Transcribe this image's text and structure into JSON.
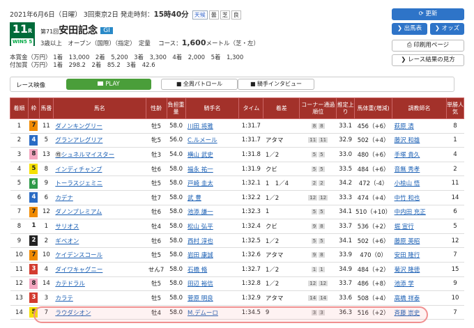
{
  "header": {
    "date": "2021年6月6日（日曜）",
    "meeting": "3回東京2日",
    "post_time_label": "発走時刻：",
    "post_time": "15時40分",
    "conditions": [
      "天候",
      "曇",
      "芝",
      "良"
    ],
    "race_no": "11",
    "race_no_suffix": "R",
    "win5_label": "WIN5",
    "win5_no": "5",
    "race_ordinal": "第71回",
    "race_name": "安田記念",
    "grade": "GI",
    "class_text": "3歳以上　オープン（国際）（指定）　定量",
    "course_label": "コース：",
    "distance": "1,600",
    "distance_unit": "メートル（芝・左）"
  },
  "prize": {
    "row1_label": "本賞金（万円）",
    "row1": "1着　13,000　2着　5,200　3着　3,300　4着　2,000　5着　1,300",
    "row2_label": "付加賞（万円）",
    "row2": "1着　298.2　2着　85.2　3着　42.6"
  },
  "buttons": {
    "refresh": "更新",
    "entries": "出馬表",
    "odds": "オッズ",
    "print": "印刷用ページ",
    "results_guide": "レース結果の見方"
  },
  "video": {
    "label": "レース映像",
    "play": "PLAY",
    "patrol": "全周パトロール",
    "interview": "騎手インタビュー"
  },
  "table": {
    "headers": [
      "着順",
      "枠",
      "馬番",
      "馬名",
      "性齢",
      "負担重量",
      "騎手名",
      "タイム",
      "着差",
      "コーナー通過順位",
      "推定上り",
      "馬体重(増減)",
      "調教師名",
      "単勝人気"
    ],
    "rows": [
      {
        "rank": "1",
        "waku": "7",
        "num": "11",
        "horse": "ダノンキングリー",
        "sex": "牡5",
        "weight": "58.0",
        "jockey": "川田 将雅",
        "time": "1:31.7",
        "margin": "",
        "corner": [
          "8",
          "8"
        ],
        "last3f": "33.1",
        "bw": "456（+6）",
        "trainer": "萩原 清",
        "pop": "8"
      },
      {
        "rank": "2",
        "waku": "4",
        "num": "5",
        "horse": "グランアレグリア",
        "sex": "牝5",
        "weight": "56.0",
        "jockey": "C.ルメール",
        "time": "1:31.7",
        "margin": "アタマ",
        "corner": [
          "11",
          "11"
        ],
        "last3f": "32.9",
        "bw": "502（+4）",
        "trainer": "藤沢 和雄",
        "pop": "1"
      },
      {
        "rank": "3",
        "waku": "8",
        "num": "13",
        "horse": "シュネルマイスター",
        "sex": "牡3",
        "weight": "54.0",
        "jockey": "横山 武史",
        "time": "1:31.8",
        "margin": "1／2",
        "corner": [
          "5",
          "5"
        ],
        "last3f": "33.0",
        "bw": "480（+6）",
        "trainer": "手塚 貴久",
        "pop": "4"
      },
      {
        "rank": "4",
        "waku": "5",
        "num": "8",
        "horse": "インディチャンプ",
        "sex": "牡6",
        "weight": "58.0",
        "jockey": "福永 祐一",
        "time": "1:31.9",
        "margin": "クビ",
        "corner": [
          "5",
          "5"
        ],
        "last3f": "33.5",
        "bw": "484（+6）",
        "trainer": "音無 秀孝",
        "pop": "2"
      },
      {
        "rank": "5",
        "waku": "6",
        "num": "9",
        "horse": "トーラスジェミニ",
        "sex": "牡5",
        "weight": "58.0",
        "jockey": "戸崎 圭太",
        "time": "1:32.1",
        "margin": "1　1／4",
        "corner": [
          "2",
          "2"
        ],
        "last3f": "34.2",
        "bw": "472（-4）",
        "trainer": "小桧山 悟",
        "pop": "11"
      },
      {
        "rank": "6",
        "waku": "4",
        "num": "6",
        "horse": "カデナ",
        "sex": "牡7",
        "weight": "58.0",
        "jockey": "武 豊",
        "time": "1:32.2",
        "margin": "1／2",
        "corner": [
          "12",
          "12"
        ],
        "last3f": "33.3",
        "bw": "474（+4）",
        "trainer": "中竹 和也",
        "pop": "14"
      },
      {
        "rank": "7",
        "waku": "7",
        "num": "12",
        "horse": "ダノンプレミアム",
        "sex": "牡6",
        "weight": "58.0",
        "jockey": "池添 謙一",
        "time": "1:32.3",
        "margin": "1",
        "corner": [
          "5",
          "5"
        ],
        "last3f": "34.1",
        "bw": "510（+10）",
        "trainer": "中内田 充正",
        "pop": "6"
      },
      {
        "rank": "8",
        "waku": "1",
        "num": "1",
        "horse": "サリオス",
        "sex": "牡4",
        "weight": "58.0",
        "jockey": "松山 弘平",
        "time": "1:32.4",
        "margin": "クビ",
        "corner": [
          "9",
          "8"
        ],
        "last3f": "33.7",
        "bw": "536（+2）",
        "trainer": "堀 宣行",
        "pop": "5"
      },
      {
        "rank": "9",
        "waku": "2",
        "num": "2",
        "horse": "ギベオン",
        "sex": "牡6",
        "weight": "58.0",
        "jockey": "西村 淳也",
        "time": "1:32.5",
        "margin": "1／2",
        "corner": [
          "5",
          "5"
        ],
        "last3f": "34.1",
        "bw": "502（+6）",
        "trainer": "藤原 英昭",
        "pop": "12"
      },
      {
        "rank": "10",
        "waku": "7",
        "num": "10",
        "horse": "ケイデンスコール",
        "sex": "牡5",
        "weight": "58.0",
        "jockey": "岩田 康誠",
        "time": "1:32.6",
        "margin": "アタマ",
        "corner": [
          "9",
          "8"
        ],
        "last3f": "33.9",
        "bw": "470（0）",
        "trainer": "安田 隆行",
        "pop": "7"
      },
      {
        "rank": "11",
        "waku": "3",
        "num": "4",
        "horse": "ダイワキャグニー",
        "sex": "せん7",
        "weight": "58.0",
        "jockey": "石橋 脩",
        "time": "1:32.7",
        "margin": "1／2",
        "corner": [
          "1",
          "1"
        ],
        "last3f": "34.9",
        "bw": "484（+2）",
        "trainer": "菊沢 隆徳",
        "pop": "15"
      },
      {
        "rank": "12",
        "waku": "8",
        "num": "14",
        "horse": "カテドラル",
        "sex": "牡5",
        "weight": "58.0",
        "jockey": "田辺 裕信",
        "time": "1:32.8",
        "margin": "1／2",
        "corner": [
          "12",
          "12"
        ],
        "last3f": "33.7",
        "bw": "486（+8）",
        "trainer": "池添 学",
        "pop": "9"
      },
      {
        "rank": "13",
        "waku": "3",
        "num": "3",
        "horse": "カラテ",
        "sex": "牡5",
        "weight": "58.0",
        "jockey": "菅原 明良",
        "time": "1:32.9",
        "margin": "アタマ",
        "corner": [
          "14",
          "14"
        ],
        "last3f": "33.6",
        "bw": "508（+4）",
        "trainer": "高橋 祥泰",
        "pop": "10"
      },
      {
        "rank": "14",
        "waku": "5",
        "num": "7",
        "horse": "ラウダシオン",
        "sex": "牡4",
        "weight": "58.0",
        "jockey": "M.デムーロ",
        "time": "1:34.5",
        "margin": "9",
        "corner": [
          "3",
          "3"
        ],
        "last3f": "36.3",
        "bw": "516（+2）",
        "trainer": "斉藤 崇史",
        "pop": "7"
      }
    ]
  },
  "colors": {
    "header_bg": "#a3312a",
    "race_badge": "#006b3a",
    "button_blue": "#2e74c8",
    "play_green": "#4a9e3a",
    "link": "#1a5fb4",
    "waku1": "#ffffff",
    "waku2": "#222222",
    "waku3": "#d33b2f",
    "waku4": "#2a6bc4",
    "waku5": "#f5e000",
    "waku6": "#2e9a48",
    "waku7": "#f08a00",
    "waku8": "#f4a7c0"
  }
}
